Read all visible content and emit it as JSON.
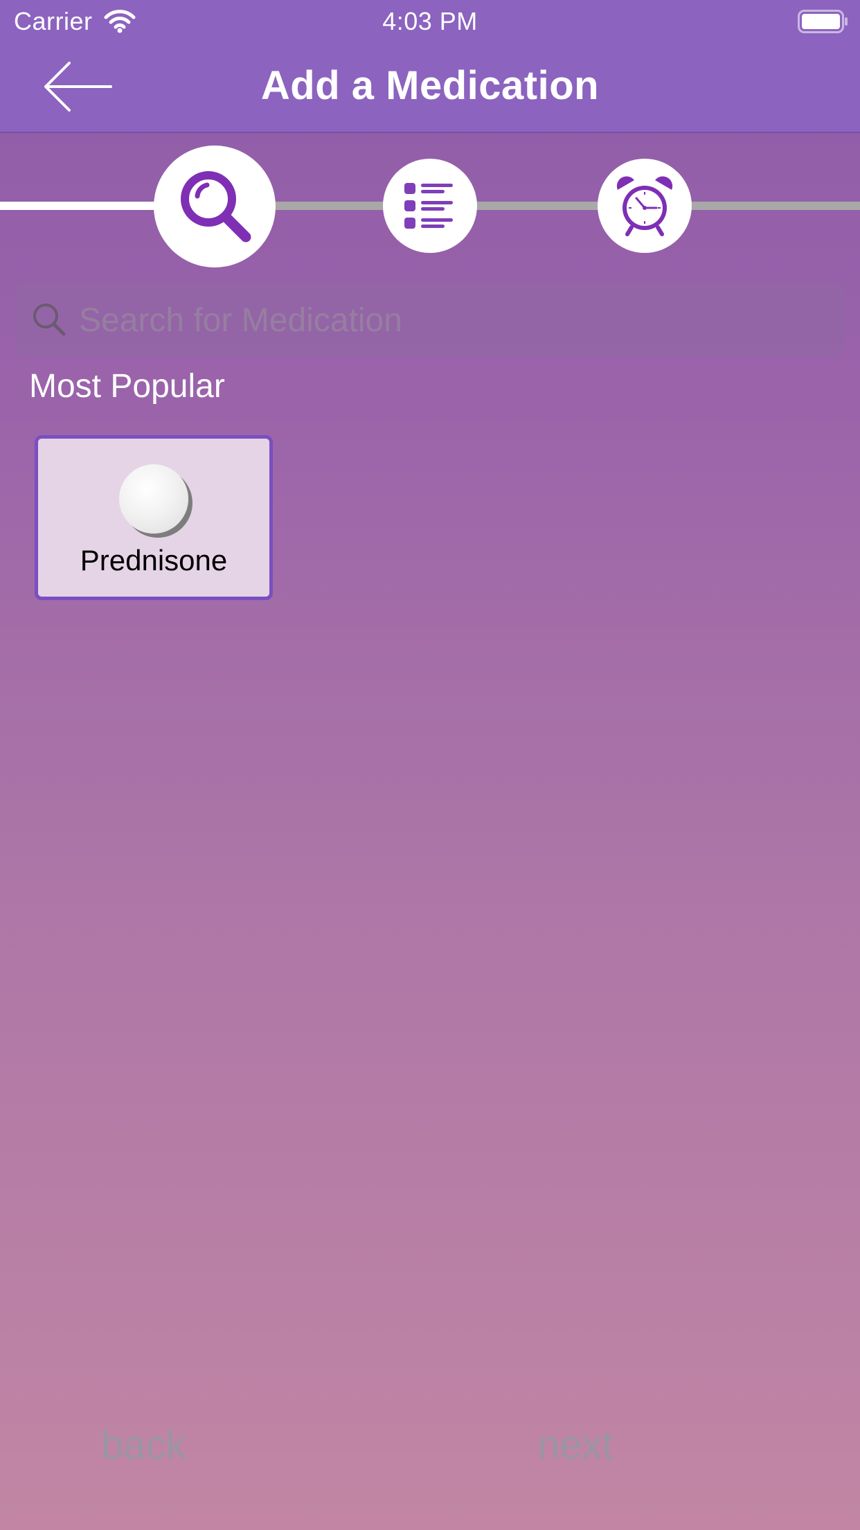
{
  "status_bar": {
    "carrier": "Carrier",
    "time": "4:03 PM",
    "wifi_icon": "wifi-icon",
    "battery_icon": "battery-icon"
  },
  "header": {
    "title": "Add a Medication",
    "back_icon": "arrow-left-icon"
  },
  "steps": {
    "items": [
      {
        "icon": "magnifier-icon",
        "active": true
      },
      {
        "icon": "list-icon",
        "active": false
      },
      {
        "icon": "alarm-clock-icon",
        "active": false
      }
    ],
    "progress_color": "#ffffff",
    "pending_color": "#a8a8a8",
    "icon_color": "#7e2fb4"
  },
  "search": {
    "placeholder": "Search for Medication",
    "value": ""
  },
  "popular": {
    "title": "Most Popular",
    "items": [
      {
        "name": "Prednisone",
        "icon": "pill-icon"
      }
    ]
  },
  "bottom_nav": {
    "back_label": "back",
    "next_label": "next"
  },
  "colors": {
    "header_bg": "#8c63bf",
    "card_border": "#7a4fc0",
    "card_bg": "#e5d4e6"
  }
}
